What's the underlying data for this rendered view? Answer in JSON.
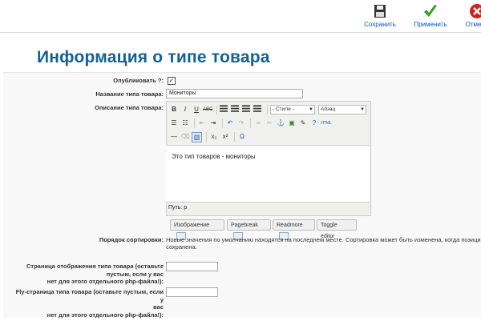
{
  "toolbar": {
    "save_label": "Сохранить",
    "apply_label": "Применить",
    "cancel_label": "Отмена"
  },
  "page_title": "Информация о типе товара",
  "form": {
    "published_label": "Опубликовать ?:",
    "published_checked": true,
    "name_label": "Название типа товара:",
    "name_value": "Мониторы",
    "description_label": "Описание типа товара:",
    "editor": {
      "styles_select": "- Стили -",
      "format_select": "Абзац",
      "content_text": "Это тип товаров - мониторы",
      "path_text": "Путь: p",
      "buttons": {
        "image": "Изображение",
        "pagebreak": "Pagebreak",
        "readmore": "Readmore",
        "toggle": "Toggle editor"
      }
    },
    "sort_label": "Порядок сортировки:",
    "sort_note_line1": "Новые значения по умолчанию находятся на последнем месте. Сортировка может быть изменена, когда позиция",
    "sort_note_line2": "сохранена.",
    "display_page_label_line1": "Страница отображения типа товара (оставьте",
    "display_page_label_line2": "пустым, если у вас",
    "display_page_label_line3": "нет для этого отдельного php-файла!):",
    "display_page_value": "",
    "fly_page_label_line1": "Fly-страница типа товара (оставьте пустым, если у",
    "fly_page_label_line2": "вас",
    "fly_page_label_line3": "нет для этого отдельного php-файла!):",
    "fly_page_value": ""
  },
  "colors": {
    "title": "#146295",
    "link": "#0b55c4",
    "accept_green": "#3a9a2a",
    "cancel_red": "#cc2222"
  }
}
